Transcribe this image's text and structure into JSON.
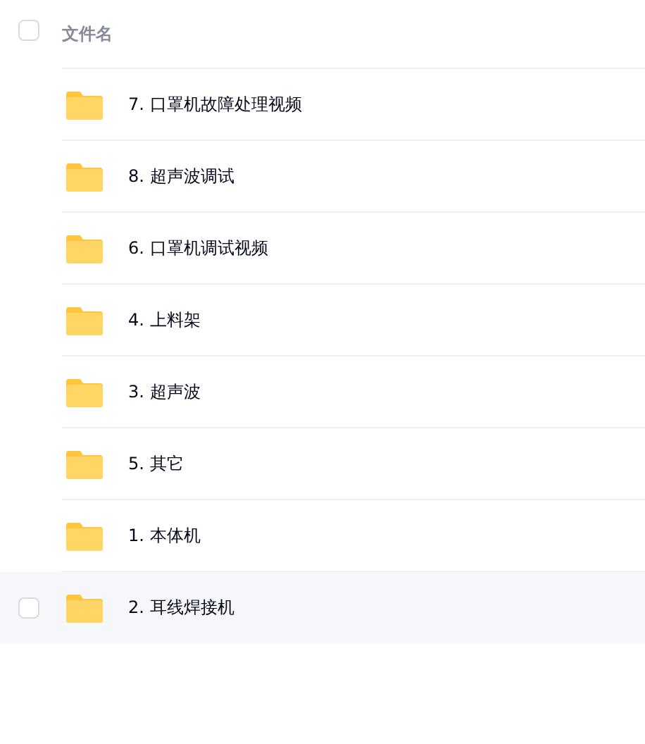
{
  "header": {
    "checked": false,
    "label": "文件名"
  },
  "rows": [
    {
      "name": "7. 口罩机故障处理视频",
      "hovered": false
    },
    {
      "name": "8. 超声波调试",
      "hovered": false
    },
    {
      "name": "6. 口罩机调试视频",
      "hovered": false
    },
    {
      "name": "4. 上料架",
      "hovered": false
    },
    {
      "name": "3. 超声波",
      "hovered": false
    },
    {
      "name": "5. 其它",
      "hovered": false
    },
    {
      "name": "1. 本体机",
      "hovered": false
    },
    {
      "name": "2. 耳线焊接机",
      "hovered": true
    }
  ]
}
